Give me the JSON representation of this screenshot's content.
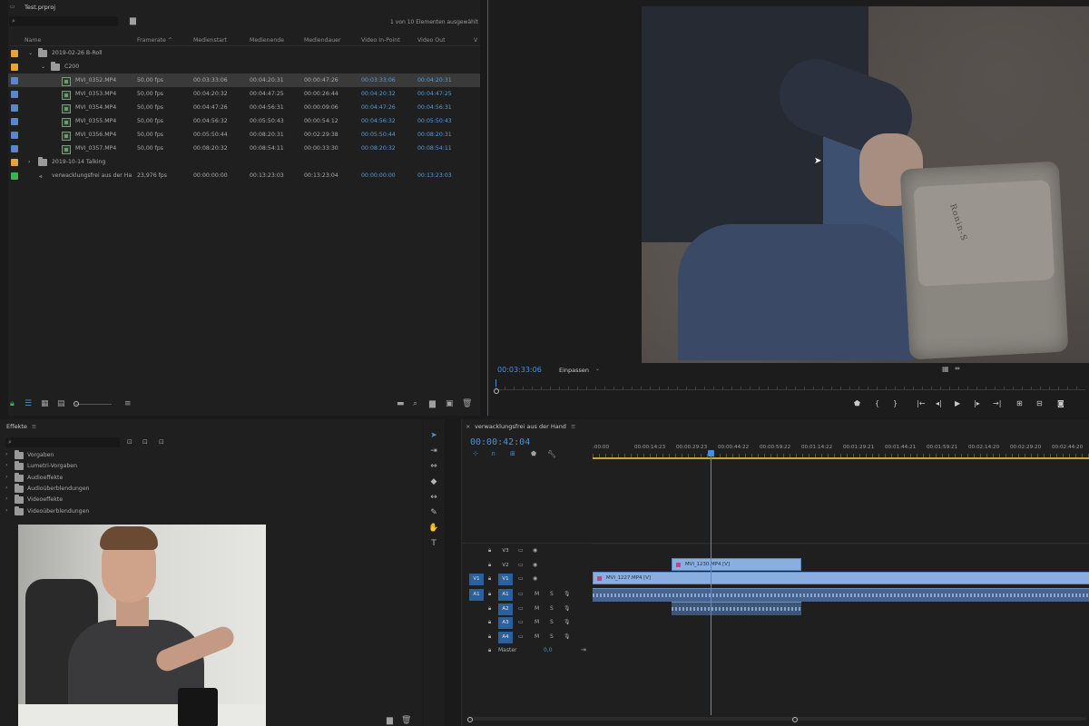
{
  "project": {
    "title": "Test.prproj",
    "item_count": "1 von 10 Elementen ausgewählt",
    "columns": [
      "Name",
      "Framerate",
      "Medienstart",
      "Medienende",
      "Mediendauer",
      "Video In-Point",
      "Video Out",
      "V"
    ],
    "rows": [
      {
        "type": "bin",
        "label_color": "#e6a23c",
        "indent": 0,
        "name": "2019-02-26 B-Roll",
        "open": true
      },
      {
        "type": "bin",
        "label_color": "#e6a23c",
        "indent": 1,
        "name": "C200",
        "open": true
      },
      {
        "type": "clip",
        "label_color": "#5b86c8",
        "name": "MVI_0352.MP4",
        "fps": "50,00 fps",
        "start": "00:03:33:06",
        "end": "00:04:20:31",
        "dur": "00:00:47:26",
        "in": "00:03:33:06",
        "out": "00:04:20:31",
        "selected": true
      },
      {
        "type": "clip",
        "label_color": "#5b86c8",
        "name": "MVI_0353.MP4",
        "fps": "50,00 fps",
        "start": "00:04:20:32",
        "end": "00:04:47:25",
        "dur": "00:00:26:44",
        "in": "00:04:20:32",
        "out": "00:04:47:25",
        "selected": false
      },
      {
        "type": "clip",
        "label_color": "#5b86c8",
        "name": "MVI_0354.MP4",
        "fps": "50,00 fps",
        "start": "00:04:47:26",
        "end": "00:04:56:31",
        "dur": "00:00:09:06",
        "in": "00:04:47:26",
        "out": "00:04:56:31",
        "selected": false
      },
      {
        "type": "clip",
        "label_color": "#5b86c8",
        "name": "MVI_0355.MP4",
        "fps": "50,00 fps",
        "start": "00:04:56:32",
        "end": "00:05:50:43",
        "dur": "00:00:54:12",
        "in": "00:04:56:32",
        "out": "00:05:50:43",
        "selected": false
      },
      {
        "type": "clip",
        "label_color": "#5b86c8",
        "name": "MVI_0356.MP4",
        "fps": "50,00 fps",
        "start": "00:05:50:44",
        "end": "00:08:20:31",
        "dur": "00:02:29:38",
        "in": "00:05:50:44",
        "out": "00:08:20:31",
        "selected": false
      },
      {
        "type": "clip",
        "label_color": "#5b86c8",
        "name": "MVI_0357.MP4",
        "fps": "50,00 fps",
        "start": "00:08:20:32",
        "end": "00:08:54:11",
        "dur": "00:00:33:30",
        "in": "00:08:20:32",
        "out": "00:08:54:11",
        "selected": false
      },
      {
        "type": "bin",
        "label_color": "#e6a23c",
        "indent": 0,
        "name": "2019-10-14 Talking",
        "open": false
      },
      {
        "type": "seq",
        "label_color": "#3fb24f",
        "name": "verwacklungsfrei aus der Ha",
        "fps": "23,976 fps",
        "start": "00:00:00:00",
        "end": "00:13:23:03",
        "dur": "00:13:23:04",
        "in": "00:00:00:00",
        "out": "00:13:23:03",
        "selected": false
      }
    ]
  },
  "monitor": {
    "timecode": "00:03:33:06",
    "fit": "Einpassen",
    "brand_text": "Ronin-S"
  },
  "effects": {
    "title": "Effekte",
    "items": [
      "Vorgaben",
      "Lumetri-Vorgaben",
      "Audioeffekte",
      "Audioüberblendungen",
      "Videoeffekte",
      "Videoüberblendungen"
    ]
  },
  "timeline": {
    "sequence_name": "verwacklungsfrei aus der Hand",
    "timecode": "00:00:42:04",
    "ruler_labels": [
      ":00:00",
      "00:00:14:23",
      "00:00:29:23",
      "00:00:44:22",
      "00:00:59:22",
      "00:01:14:22",
      "00:01:29:21",
      "00:01:44:21",
      "00:01:59:21",
      "00:02:14:20",
      "00:02:29:20",
      "00:02:44:20"
    ],
    "video_tracks": [
      "V3",
      "V2",
      "V1"
    ],
    "audio_tracks": [
      "A1",
      "A2",
      "A3",
      "A4"
    ],
    "master_label": "Master",
    "master_value": "0,0",
    "clip_v2": "MVI_1230.MP4 [V]",
    "clip_v1": "MVI_1227.MP4 [V]"
  },
  "colors": {
    "accent": "#4d8fd6",
    "bin": "#e6a23c",
    "clip": "#5b86c8",
    "sequence": "#3fb24f"
  }
}
